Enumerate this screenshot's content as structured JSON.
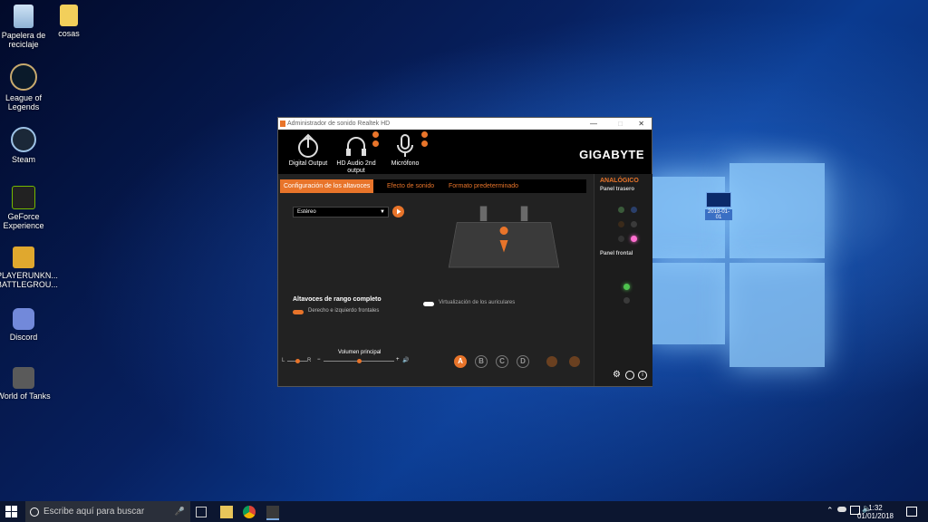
{
  "desktop": {
    "icons": [
      {
        "label": "Papelera de reciclaje"
      },
      {
        "label": "cosas"
      },
      {
        "label": "League of Legends"
      },
      {
        "label": "Steam"
      },
      {
        "label": "GeForce Experience"
      },
      {
        "label": "PLAYERUNKN... BATTLEGROU..."
      },
      {
        "label": "Discord"
      },
      {
        "label": "World of Tanks"
      }
    ],
    "floating_label": "2018-01-01"
  },
  "taskbar": {
    "search_placeholder": "Escribe aquí para buscar",
    "time": "1:32",
    "date": "01/01/2018"
  },
  "app": {
    "title": "Administrador de sonido Realtek HD",
    "brand": "GIGABYTE",
    "devices": [
      {
        "label": "Digital Output"
      },
      {
        "label": "HD Audio 2nd output"
      },
      {
        "label": "Micrófono"
      }
    ],
    "tabs": [
      {
        "label": "Configuración de los altavoces",
        "active": true
      },
      {
        "label": "Efecto de sonido",
        "active": false
      },
      {
        "label": "Formato predeterminado",
        "active": false
      }
    ],
    "speaker_config_value": "Estéreo",
    "fullrange_title": "Altavoces de rango completo",
    "fullrange_option": "Derecho e izquierdo frontales",
    "headphone_virtualization": "Virtualización de los auriculares",
    "volume": {
      "label": "Volumen principal",
      "left": "L",
      "right": "R",
      "balance_fraction": 0.5,
      "level_fraction": 0.5
    },
    "profiles": [
      "A",
      "B",
      "C",
      "D"
    ],
    "side": {
      "analog_title": "ANALÓGICO",
      "rear_panel": "Panel trasero",
      "front_panel": "Panel frontal"
    },
    "colors": {
      "accent": "#e8742a"
    }
  }
}
